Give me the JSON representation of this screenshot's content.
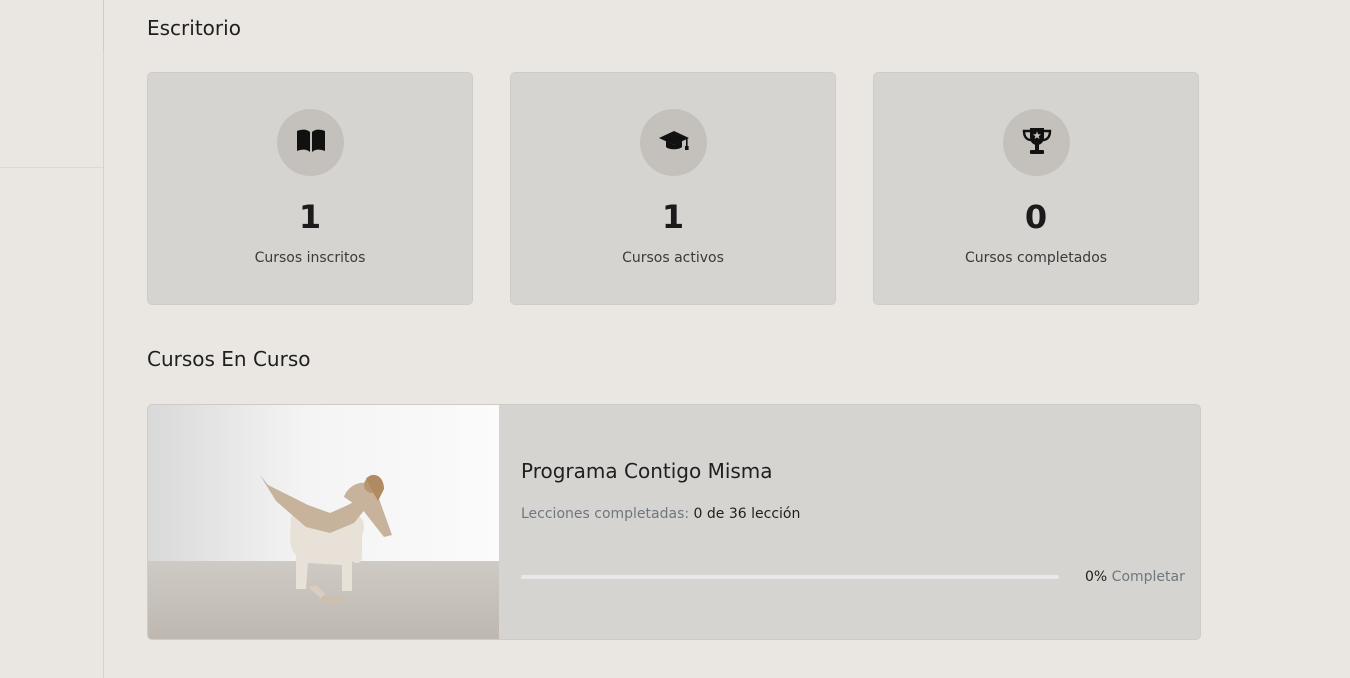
{
  "page": {
    "title": "Escritorio"
  },
  "stats": [
    {
      "icon": "open-book-icon",
      "value": "1",
      "label": "Cursos inscritos"
    },
    {
      "icon": "graduation-cap-icon",
      "value": "1",
      "label": "Cursos activos"
    },
    {
      "icon": "trophy-icon",
      "value": "0",
      "label": "Cursos completados"
    }
  ],
  "in_progress": {
    "section_title": "Cursos En Curso",
    "course": {
      "title": "Programa Contigo Misma",
      "lessons_label": "Lecciones completadas:",
      "lessons_count": "0 de 36 lección",
      "progress_percent_text": "0%",
      "progress_word": "Completar",
      "progress_fraction": 0
    }
  }
}
